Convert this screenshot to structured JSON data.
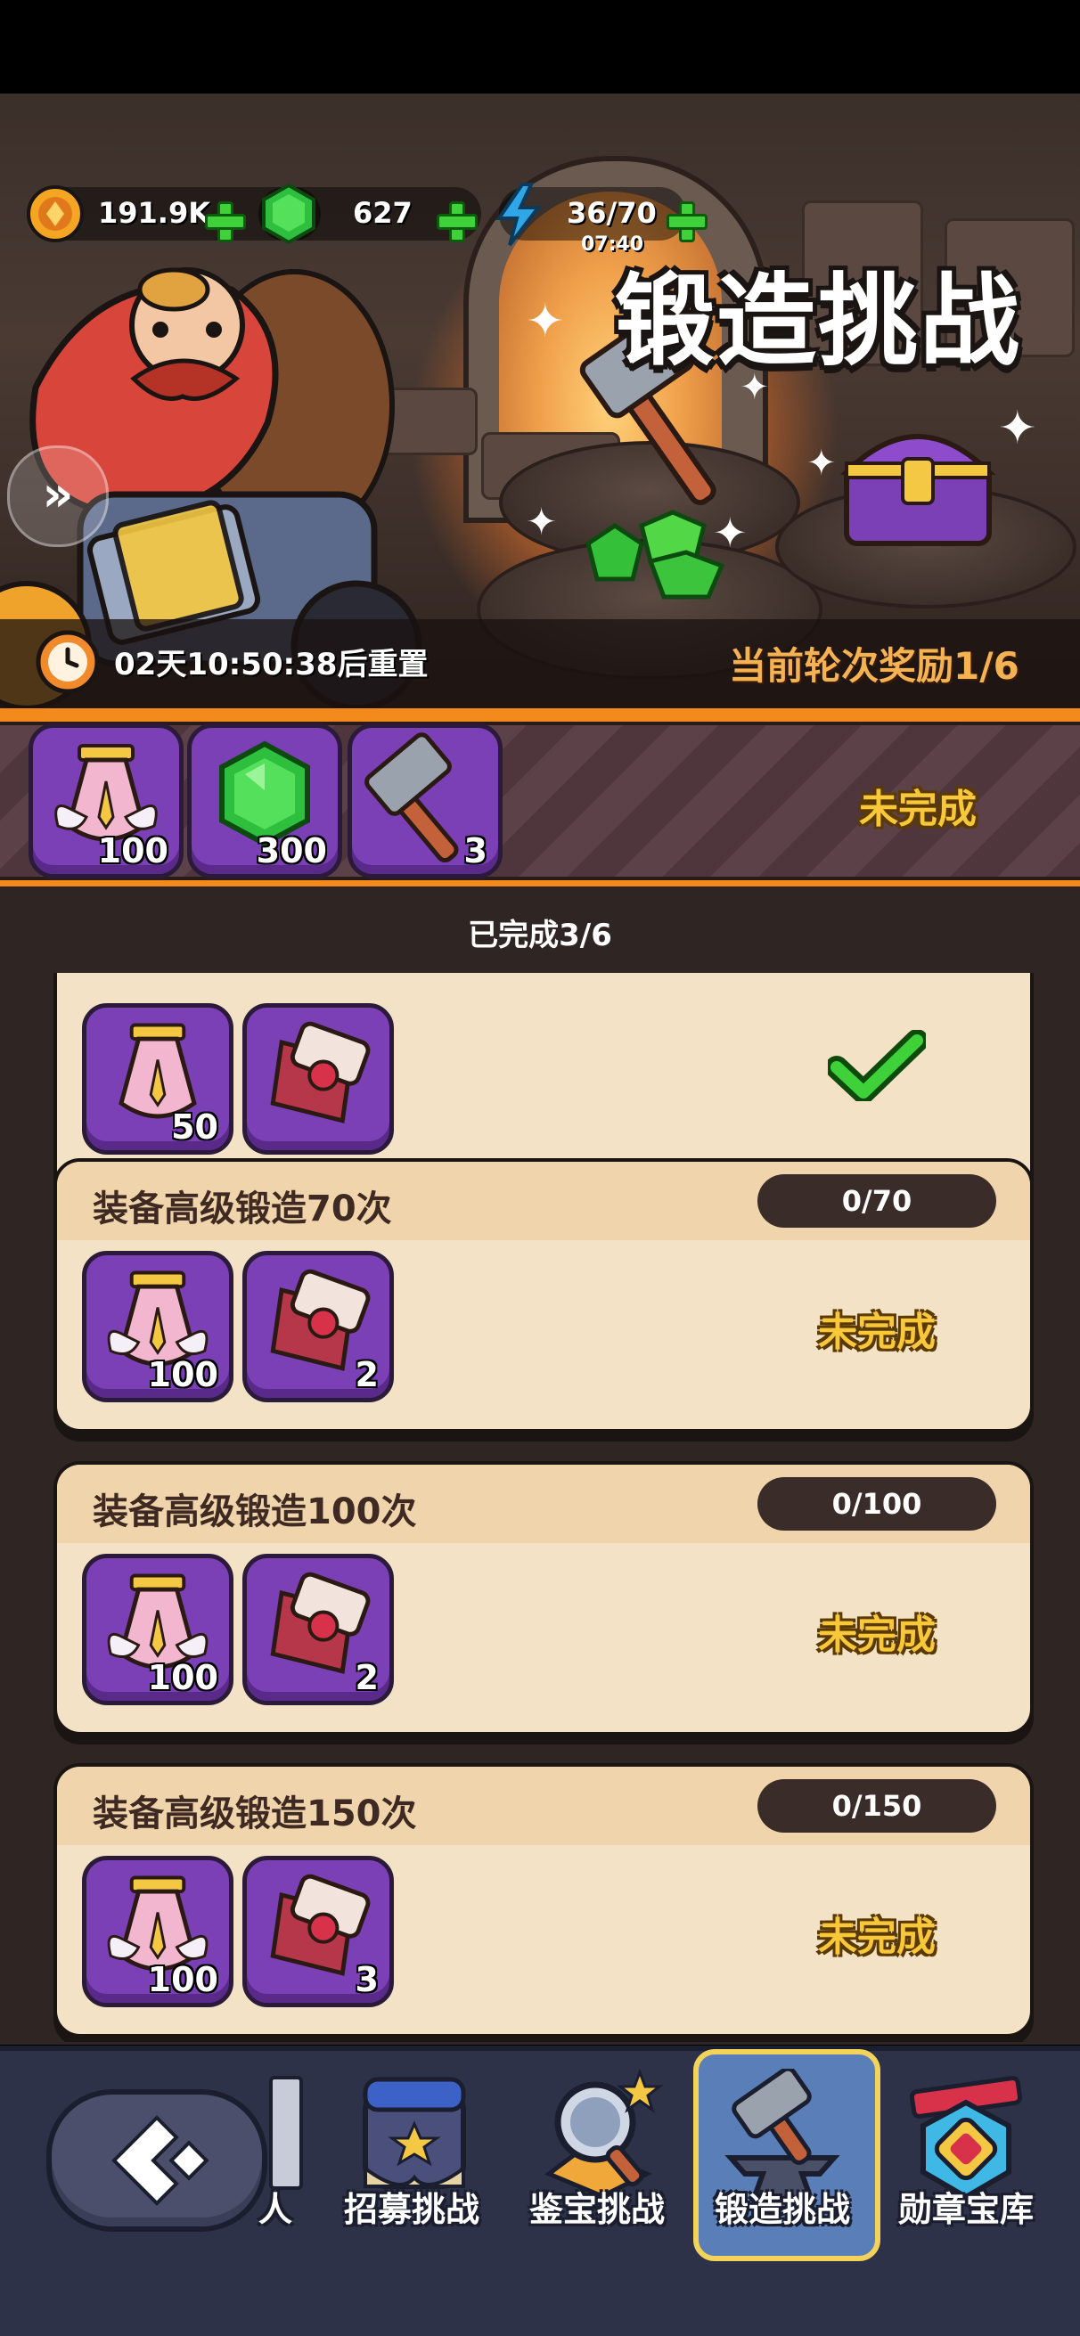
{
  "top_bar": {
    "gold": "191.9K",
    "gems": "627",
    "energy": "36/70",
    "energy_timer": "07:40"
  },
  "banner": {
    "title": "锻造挑战",
    "reset_timer": "02天10:50:38后重置",
    "round_reward": "当前轮次奖励1/6"
  },
  "round_rewards": {
    "items": [
      {
        "icon": "medal-potion-icon",
        "qty": "100"
      },
      {
        "icon": "green-gem-icon",
        "qty": "300"
      },
      {
        "icon": "forge-hammer-icon",
        "qty": "3"
      }
    ],
    "status": "未完成"
  },
  "progress": "已完成3/6",
  "tasks": [
    {
      "title": "",
      "progress": "",
      "items": [
        {
          "icon": "medal-potion-icon",
          "qty": "50"
        },
        {
          "icon": "scroll-icon",
          "qty": ""
        }
      ],
      "status": "completed"
    },
    {
      "title": "装备高级锻造70次",
      "progress": "0/70",
      "items": [
        {
          "icon": "medal-potion-icon",
          "qty": "100"
        },
        {
          "icon": "scroll-icon",
          "qty": "2"
        }
      ],
      "status": "未完成"
    },
    {
      "title": "装备高级锻造100次",
      "progress": "0/100",
      "items": [
        {
          "icon": "medal-potion-icon",
          "qty": "100"
        },
        {
          "icon": "scroll-icon",
          "qty": "2"
        }
      ],
      "status": "未完成"
    },
    {
      "title": "装备高级锻造150次",
      "progress": "0/150",
      "items": [
        {
          "icon": "medal-potion-icon",
          "qty": "100"
        },
        {
          "icon": "scroll-icon",
          "qty": "3"
        }
      ],
      "status": "未完成"
    }
  ],
  "bottom_nav": {
    "partial_label": "人",
    "items": [
      {
        "label": "招募挑战",
        "icon": "recruit-scroll-icon"
      },
      {
        "label": "鉴宝挑战",
        "icon": "magnifier-icon"
      },
      {
        "label": "锻造挑战",
        "icon": "anvil-hammer-icon",
        "active": true
      },
      {
        "label": "勋章宝库",
        "icon": "medal-vault-icon"
      }
    ]
  },
  "colors": {
    "accent_orange": "#f28b1c",
    "status_yellow": "#f8c73a",
    "item_purple": "#7b3fb6",
    "check_green": "#3ed13a"
  }
}
